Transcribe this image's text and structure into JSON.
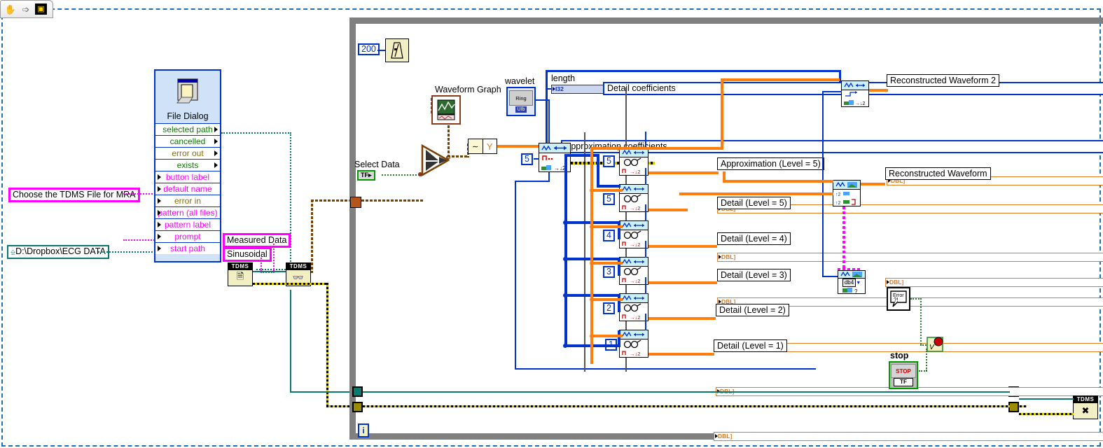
{
  "window": {
    "toolbar_buttons": [
      {
        "name": "hand-tool",
        "glyph": "✋"
      },
      {
        "name": "arrow-right",
        "glyph": "➩"
      },
      {
        "name": "labview-icon",
        "glyph": "▣"
      }
    ]
  },
  "left_panel": {
    "prompt_label": "Choose the TDMS File for MRA",
    "start_path_label": "D:\\Dropbox\\ECG DATA",
    "file_dialog": {
      "title": "File Dialog",
      "outputs": [
        "selected path",
        "cancelled",
        "error out",
        "exists"
      ],
      "inputs": [
        "button label",
        "default name",
        "error in",
        "pattern (all files)",
        "pattern label",
        "prompt",
        "start path"
      ]
    },
    "measured_data_label": "Measured Data",
    "sinusoidal_label": "Sinusoidal",
    "tdms_open_label": "TDMS",
    "tdms_read_label": "TDMS"
  },
  "loop": {
    "iteration_terminal": "i",
    "wait_constant": "200",
    "select_data_label": "Select Data",
    "select_data_value": "TF",
    "waveform_graph_label": "Waveform Graph",
    "wavelet_label": "wavelet",
    "wavelet_ring_value": "Ring",
    "wavelet_rep": "UIb",
    "length_label": "length",
    "length_type": "I32",
    "detail_coeff_enum": "Detail coefficients",
    "approx_coeff_enum": "Approximation coefficients",
    "levels": [
      "5",
      "5",
      "5",
      "4",
      "3",
      "2",
      "1"
    ],
    "wavelet_select_value": "db4",
    "stop_label": "stop",
    "stop_value": "STOP",
    "stop_tf": "TF",
    "error_icon_label": "Error ?!",
    "dbl_terminal_label": "DBL]",
    "indicators": [
      "Reconstructed Waveform  2",
      "Approximation (Level = 5)",
      "Reconstructed Waveform",
      "Detail (Level = 5)",
      "Detail (Level = 4)",
      "Detail (Level = 3)",
      "Detail (Level = 2)",
      "Detail (Level = 1)"
    ],
    "tdms_close_label": "TDMS"
  },
  "colors": {
    "wire_blue": "#0033cc",
    "wire_orange": "#ff7f0e",
    "wire_brown": "#7b3f00",
    "wire_teal": "#0a7a6f",
    "wire_magenta": "#ff00ff",
    "wire_error": "#b8a000",
    "loop_border": "#808080",
    "diagram_border": "#1f6fb4"
  }
}
